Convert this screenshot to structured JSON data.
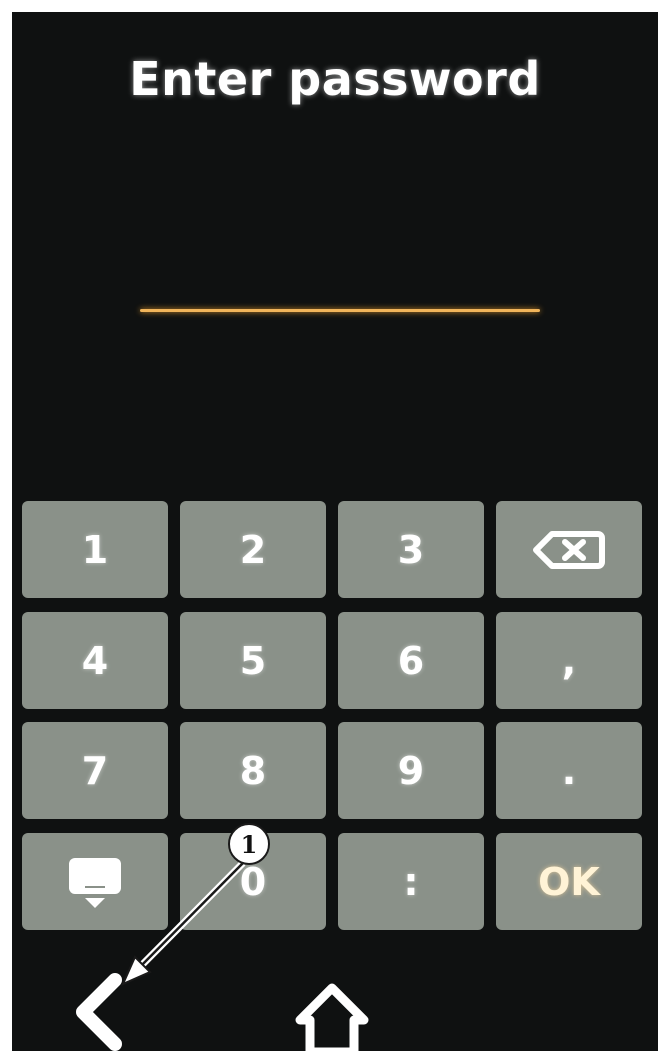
{
  "header": {
    "title": "Enter password"
  },
  "password_field": {
    "value": ""
  },
  "keypad": {
    "keys": [
      {
        "label": "1",
        "icon": null
      },
      {
        "label": "2",
        "icon": null
      },
      {
        "label": "3",
        "icon": null
      },
      {
        "label": "",
        "icon": "backspace-icon"
      },
      {
        "label": "4",
        "icon": null
      },
      {
        "label": "5",
        "icon": null
      },
      {
        "label": "6",
        "icon": null
      },
      {
        "label": ",",
        "icon": null
      },
      {
        "label": "7",
        "icon": null
      },
      {
        "label": "8",
        "icon": null
      },
      {
        "label": "9",
        "icon": null
      },
      {
        "label": ".",
        "icon": null
      },
      {
        "label": "",
        "icon": "hide-keyboard-icon"
      },
      {
        "label": "0",
        "icon": null
      },
      {
        "label": ":",
        "icon": null
      },
      {
        "label": "OK",
        "icon": null
      }
    ]
  },
  "navbar": {
    "back_icon": "back-chevron-icon",
    "home_icon": "home-icon"
  },
  "annotation": {
    "number": "1"
  },
  "colors": {
    "screen_bg": "#0f1111",
    "key_bg": "#8a9189",
    "field_underline": "#f0b45a",
    "text": "#ffffff"
  }
}
